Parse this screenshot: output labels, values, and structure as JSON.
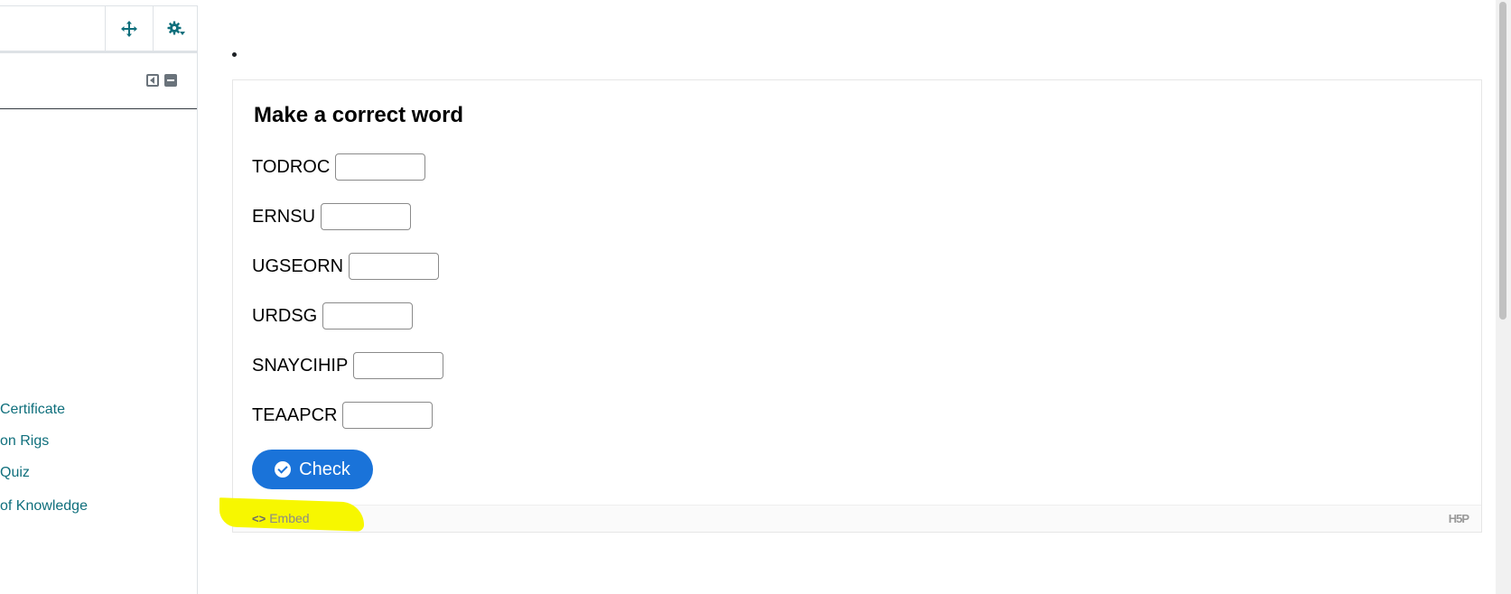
{
  "sidebar": {
    "move_icon": "move-arrows-icon",
    "gear_icon": "gear-icon",
    "links": [
      {
        "label": "Certificate"
      },
      {
        "label": "on Rigs"
      },
      {
        "label": "Quiz"
      },
      {
        "label": "of Knowledge"
      }
    ]
  },
  "activity": {
    "title": "Make a correct word",
    "puzzles": [
      {
        "scrambled": "TODROC",
        "answer": ""
      },
      {
        "scrambled": "ERNSU",
        "answer": ""
      },
      {
        "scrambled": "UGSEORN",
        "answer": ""
      },
      {
        "scrambled": "URDSG",
        "answer": ""
      },
      {
        "scrambled": "SNAYCIHIP",
        "answer": ""
      },
      {
        "scrambled": "TEAAPCR",
        "answer": ""
      }
    ],
    "check_label": "Check",
    "embed_icon": "<>",
    "embed_label": "Embed",
    "logo_text": "H5P"
  },
  "colors": {
    "accent": "#1a73d9",
    "link": "#0f6f7c",
    "highlight": "#f7f700"
  }
}
